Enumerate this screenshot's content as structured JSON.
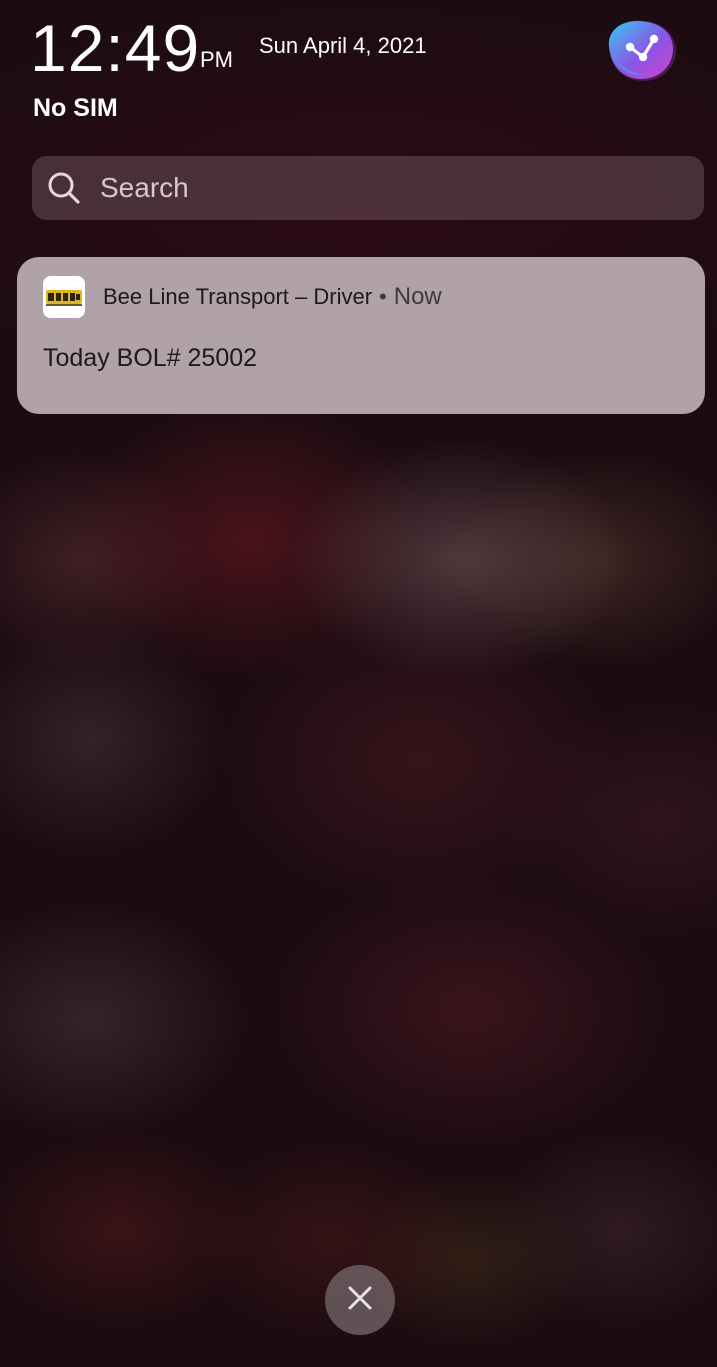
{
  "status": {
    "time": "12:49",
    "ampm": "PM",
    "date": "Sun April 4, 2021",
    "carrier": "No SIM",
    "assistant_icon": "assistant-icon"
  },
  "search": {
    "placeholder": "Search",
    "icon": "search-icon"
  },
  "notification": {
    "app_name": "Bee Line Transport – Driver",
    "separator": "•",
    "time": "Now",
    "body": "Today BOL# 25002",
    "app_icon": "bee-line-app-icon"
  },
  "footer": {
    "close_icon": "close-icon"
  },
  "colors": {
    "card_background": "#b1a1a8",
    "text_primary": "#ffffff",
    "card_text": "#1d1a1c"
  }
}
